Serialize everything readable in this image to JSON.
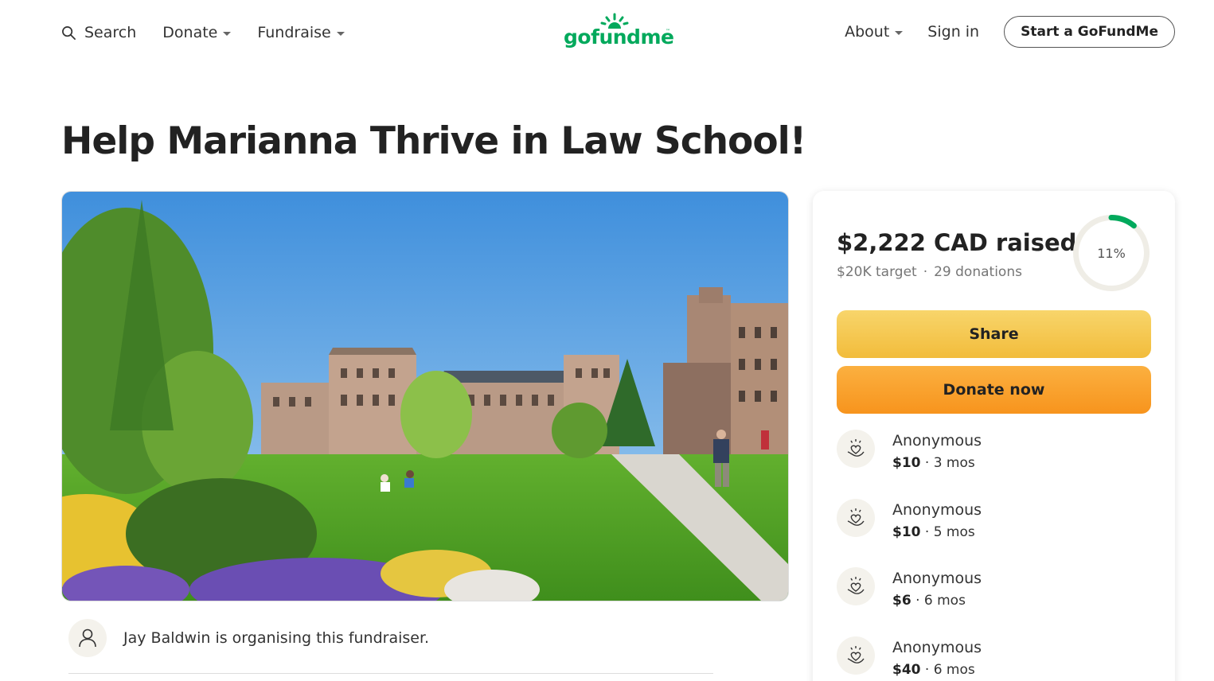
{
  "header": {
    "search_label": "Search",
    "donate_label": "Donate",
    "fundraise_label": "Fundraise",
    "logo_text": "gofundme",
    "logo_tm": "™",
    "about_label": "About",
    "signin_label": "Sign in",
    "start_label": "Start a GoFundMe"
  },
  "campaign": {
    "title": "Help Marianna Thrive in Law School!",
    "organizer_text": "Jay Baldwin is organising this fundraiser."
  },
  "progress": {
    "raised": "$2,222 CAD raised",
    "target": "$20K target",
    "separator": "·",
    "donations_count": "29 donations",
    "percent_label": "11%",
    "percent_value": 0.11
  },
  "buttons": {
    "share": "Share",
    "donate_now": "Donate now"
  },
  "donations": [
    {
      "name": "Anonymous",
      "amount": "$10",
      "time": " · 3 mos"
    },
    {
      "name": "Anonymous",
      "amount": "$10",
      "time": " · 5 mos"
    },
    {
      "name": "Anonymous",
      "amount": "$6",
      "time": " · 6 mos"
    },
    {
      "name": "Anonymous",
      "amount": "$40",
      "time": " · 6 mos"
    }
  ],
  "colors": {
    "brand": "#02a95c",
    "share_button": "#f4c44c",
    "donate_button": "#f8a22e"
  },
  "icons": {
    "search": "search-icon",
    "person": "user-icon",
    "donation": "heart-hand-icon"
  }
}
